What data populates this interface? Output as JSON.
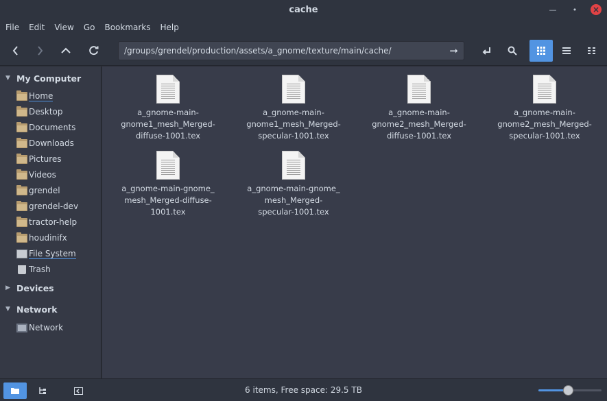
{
  "window": {
    "title": "cache"
  },
  "menu": [
    "File",
    "Edit",
    "View",
    "Go",
    "Bookmarks",
    "Help"
  ],
  "toolbar": {
    "location": "/groups/grendel/production/assets/a_gnome/texture/main/cache/",
    "view_mode": "icons"
  },
  "sidebar": {
    "sections": {
      "my_computer": "My Computer",
      "devices": "Devices",
      "network": "Network"
    },
    "places": [
      "Home",
      "Desktop",
      "Documents",
      "Downloads",
      "Pictures",
      "Videos",
      "grendel",
      "grendel-dev",
      "tractor-help",
      "houdinifx",
      "File System",
      "Trash"
    ],
    "network_items": [
      "Network"
    ]
  },
  "files": [
    {
      "name": "a_gnome-main-gnome1_mesh_Merged-diffuse-1001.tex",
      "lines": [
        "a_gnome-main-",
        "gnome1_mesh_Merged-",
        "diffuse-1001.tex"
      ]
    },
    {
      "name": "a_gnome-main-gnome1_mesh_Merged-specular-1001.tex",
      "lines": [
        "a_gnome-main-",
        "gnome1_mesh_Merged-",
        "specular-1001.tex"
      ]
    },
    {
      "name": "a_gnome-main-gnome2_mesh_Merged-diffuse-1001.tex",
      "lines": [
        "a_gnome-main-",
        "gnome2_mesh_Merged-",
        "diffuse-1001.tex"
      ]
    },
    {
      "name": "a_gnome-main-gnome2_mesh_Merged-specular-1001.tex",
      "lines": [
        "a_gnome-main-",
        "gnome2_mesh_Merged-",
        "specular-1001.tex"
      ]
    },
    {
      "name": "a_gnome-main-gnome_mesh_Merged-diffuse-1001.tex",
      "lines": [
        "a_gnome-main-gnome_",
        "mesh_Merged-diffuse-",
        "1001.tex"
      ]
    },
    {
      "name": "a_gnome-main-gnome_mesh_Merged-specular-1001.tex",
      "lines": [
        "a_gnome-main-gnome_",
        "mesh_Merged-",
        "specular-1001.tex"
      ]
    }
  ],
  "status": {
    "text": "6 items, Free space: 29.5 TB",
    "zoom_level": 0.48
  },
  "colors": {
    "accent": "#5294e2",
    "close": "#e14245",
    "folder": "#b79c6f"
  }
}
